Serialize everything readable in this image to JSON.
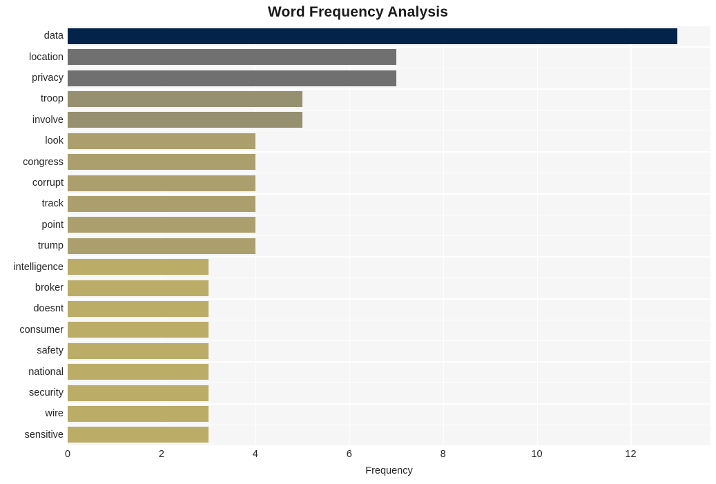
{
  "chart_data": {
    "type": "bar",
    "orientation": "horizontal",
    "title": "Word Frequency Analysis",
    "xlabel": "Frequency",
    "ylabel": "",
    "categories": [
      "data",
      "location",
      "privacy",
      "troop",
      "involve",
      "look",
      "congress",
      "corrupt",
      "track",
      "point",
      "trump",
      "intelligence",
      "broker",
      "doesnt",
      "consumer",
      "safety",
      "national",
      "security",
      "wire",
      "sensitive"
    ],
    "values": [
      13,
      7,
      7,
      5,
      5,
      4,
      4,
      4,
      4,
      4,
      4,
      3,
      3,
      3,
      3,
      3,
      3,
      3,
      3,
      3
    ],
    "bar_colors": [
      "#04234a",
      "#707070",
      "#707070",
      "#969070",
      "#969070",
      "#ab9f6d",
      "#ab9f6d",
      "#ab9f6d",
      "#ab9f6d",
      "#ab9f6d",
      "#ab9f6d",
      "#bbac68",
      "#bbac68",
      "#bbac68",
      "#bbac68",
      "#bbac68",
      "#bbac68",
      "#bbac68",
      "#bbac68",
      "#bbac68"
    ],
    "xlim": [
      0,
      13.7
    ],
    "xticks": [
      0,
      2,
      4,
      6,
      8,
      10,
      12
    ],
    "xtick_labels": [
      "0",
      "2",
      "4",
      "6",
      "8",
      "10",
      "12"
    ],
    "grid": true,
    "grid_color": "#ffffff",
    "plot_background": "#f6f6f6",
    "figure_background": "#ffffff",
    "legend": null
  }
}
